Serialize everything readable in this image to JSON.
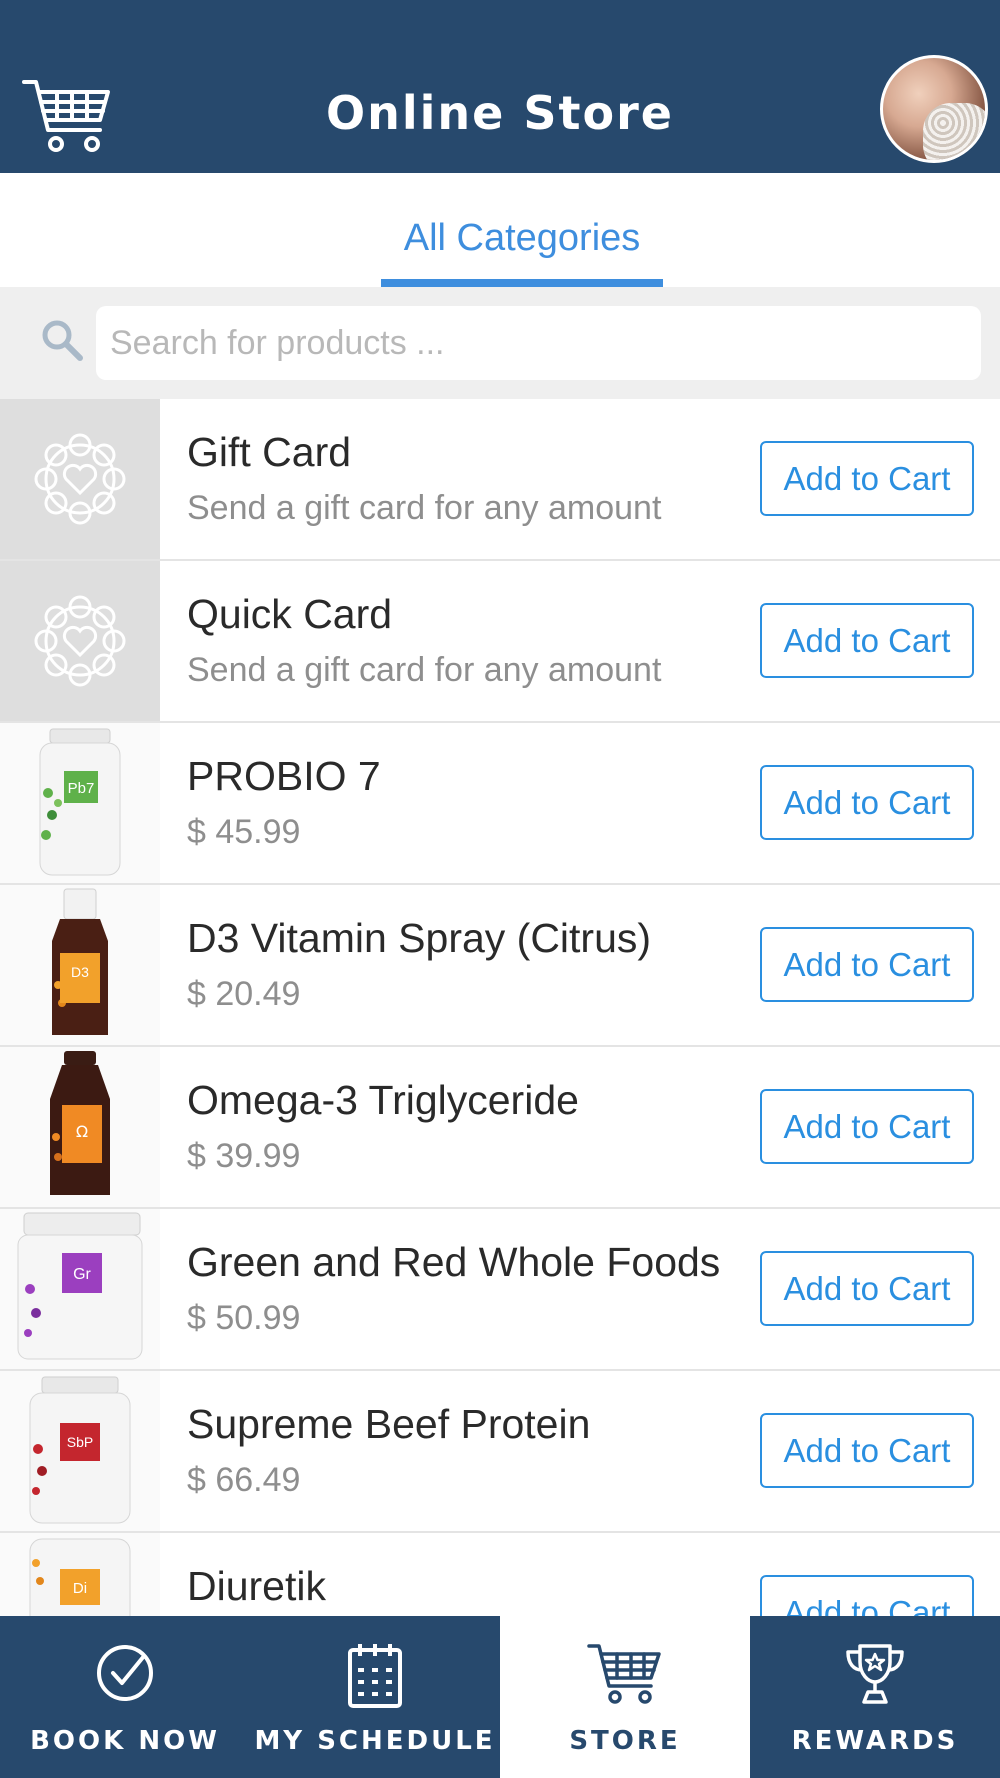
{
  "header": {
    "title": "Online Store",
    "cart_icon": "cart-icon",
    "avatar": "user-avatar"
  },
  "tabs": [
    {
      "label": "All Categories",
      "active": true
    }
  ],
  "search": {
    "placeholder": "Search for products ...",
    "value": "",
    "icon": "search-icon"
  },
  "products": [
    {
      "name": "Gift Card",
      "subtitle": "Send a gift card for any amount",
      "button": "Add to Cart",
      "thumb": "gift-card-logo-icon"
    },
    {
      "name": "Quick Card",
      "subtitle": "Send a gift card for any amount",
      "button": "Add to Cart",
      "thumb": "gift-card-logo-icon"
    },
    {
      "name": "PROBIO 7",
      "subtitle": "$ 45.99",
      "button": "Add to Cart",
      "thumb": "bottle-pb7",
      "label_text": "Pb7",
      "label_color": "#5fb14a"
    },
    {
      "name": "D3 Vitamin Spray (Citrus)",
      "subtitle": "$ 20.49",
      "button": "Add to Cart",
      "thumb": "bottle-d3",
      "label_text": "D3",
      "label_color": "#f2a12b"
    },
    {
      "name": "Omega-3 Triglyceride",
      "subtitle": "$ 39.99",
      "button": "Add to Cart",
      "thumb": "bottle-omega",
      "label_text": "Ω",
      "label_color": "#f08a24"
    },
    {
      "name": "Green and Red Whole Foods",
      "subtitle": "$ 50.99",
      "button": "Add to Cart",
      "thumb": "jar-gr",
      "label_text": "Gr",
      "label_color": "#9b3fbf"
    },
    {
      "name": "Supreme Beef Protein",
      "subtitle": "$ 66.49",
      "button": "Add to Cart",
      "thumb": "bottle-sbp",
      "label_text": "SbP",
      "label_color": "#c4262e"
    },
    {
      "name": "Diuretik",
      "subtitle": "",
      "button": "Add to Cart",
      "thumb": "bottle-di",
      "label_text": "Di",
      "label_color": "#f2a12b"
    }
  ],
  "bottom_nav": [
    {
      "label": "BOOK NOW",
      "icon": "check-circle-icon",
      "active": false
    },
    {
      "label": "MY SCHEDULE",
      "icon": "calendar-icon",
      "active": false
    },
    {
      "label": "STORE",
      "icon": "cart-icon",
      "active": true
    },
    {
      "label": "REWARDS",
      "icon": "trophy-icon",
      "active": false
    }
  ],
  "colors": {
    "header_bg": "#27496d",
    "accent": "#3e8ede",
    "button": "#2a8fe0"
  }
}
